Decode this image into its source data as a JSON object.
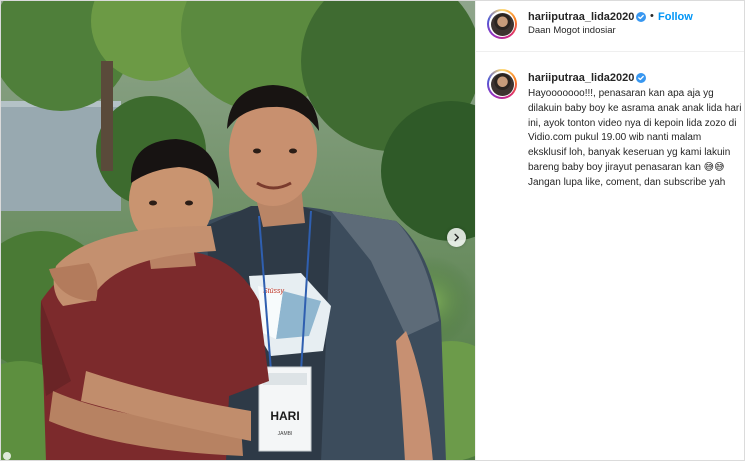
{
  "post": {
    "username": "hariiputraa_lida2020",
    "follow_label": "Follow",
    "separator": "•",
    "location": "Daan Mogot indosiar",
    "caption": "Hayooooooo!!!, penasaran kan apa aja yg dilakuin baby boy ke asrama anak anak lida hari ini, ayok tonton video nya di kepoin lida zozo di Vidio.com pukul 19.00 wib nanti malam eksklusif loh, banyak keseruan yg kami lakuin bareng baby boy jirayut penasaran kan 😅😅\nJangan lupa like, coment, dan subscribe yah"
  },
  "photo": {
    "name_tag": "HARI",
    "name_tag_sub": "JAMBI",
    "shirt_print": "Stüssy"
  },
  "colors": {
    "verified": "#3897f0",
    "follow": "#0095f6",
    "border": "#dbdbdb"
  },
  "icons": {
    "verified": "verified-badge-icon",
    "next": "chevron-right-icon"
  }
}
